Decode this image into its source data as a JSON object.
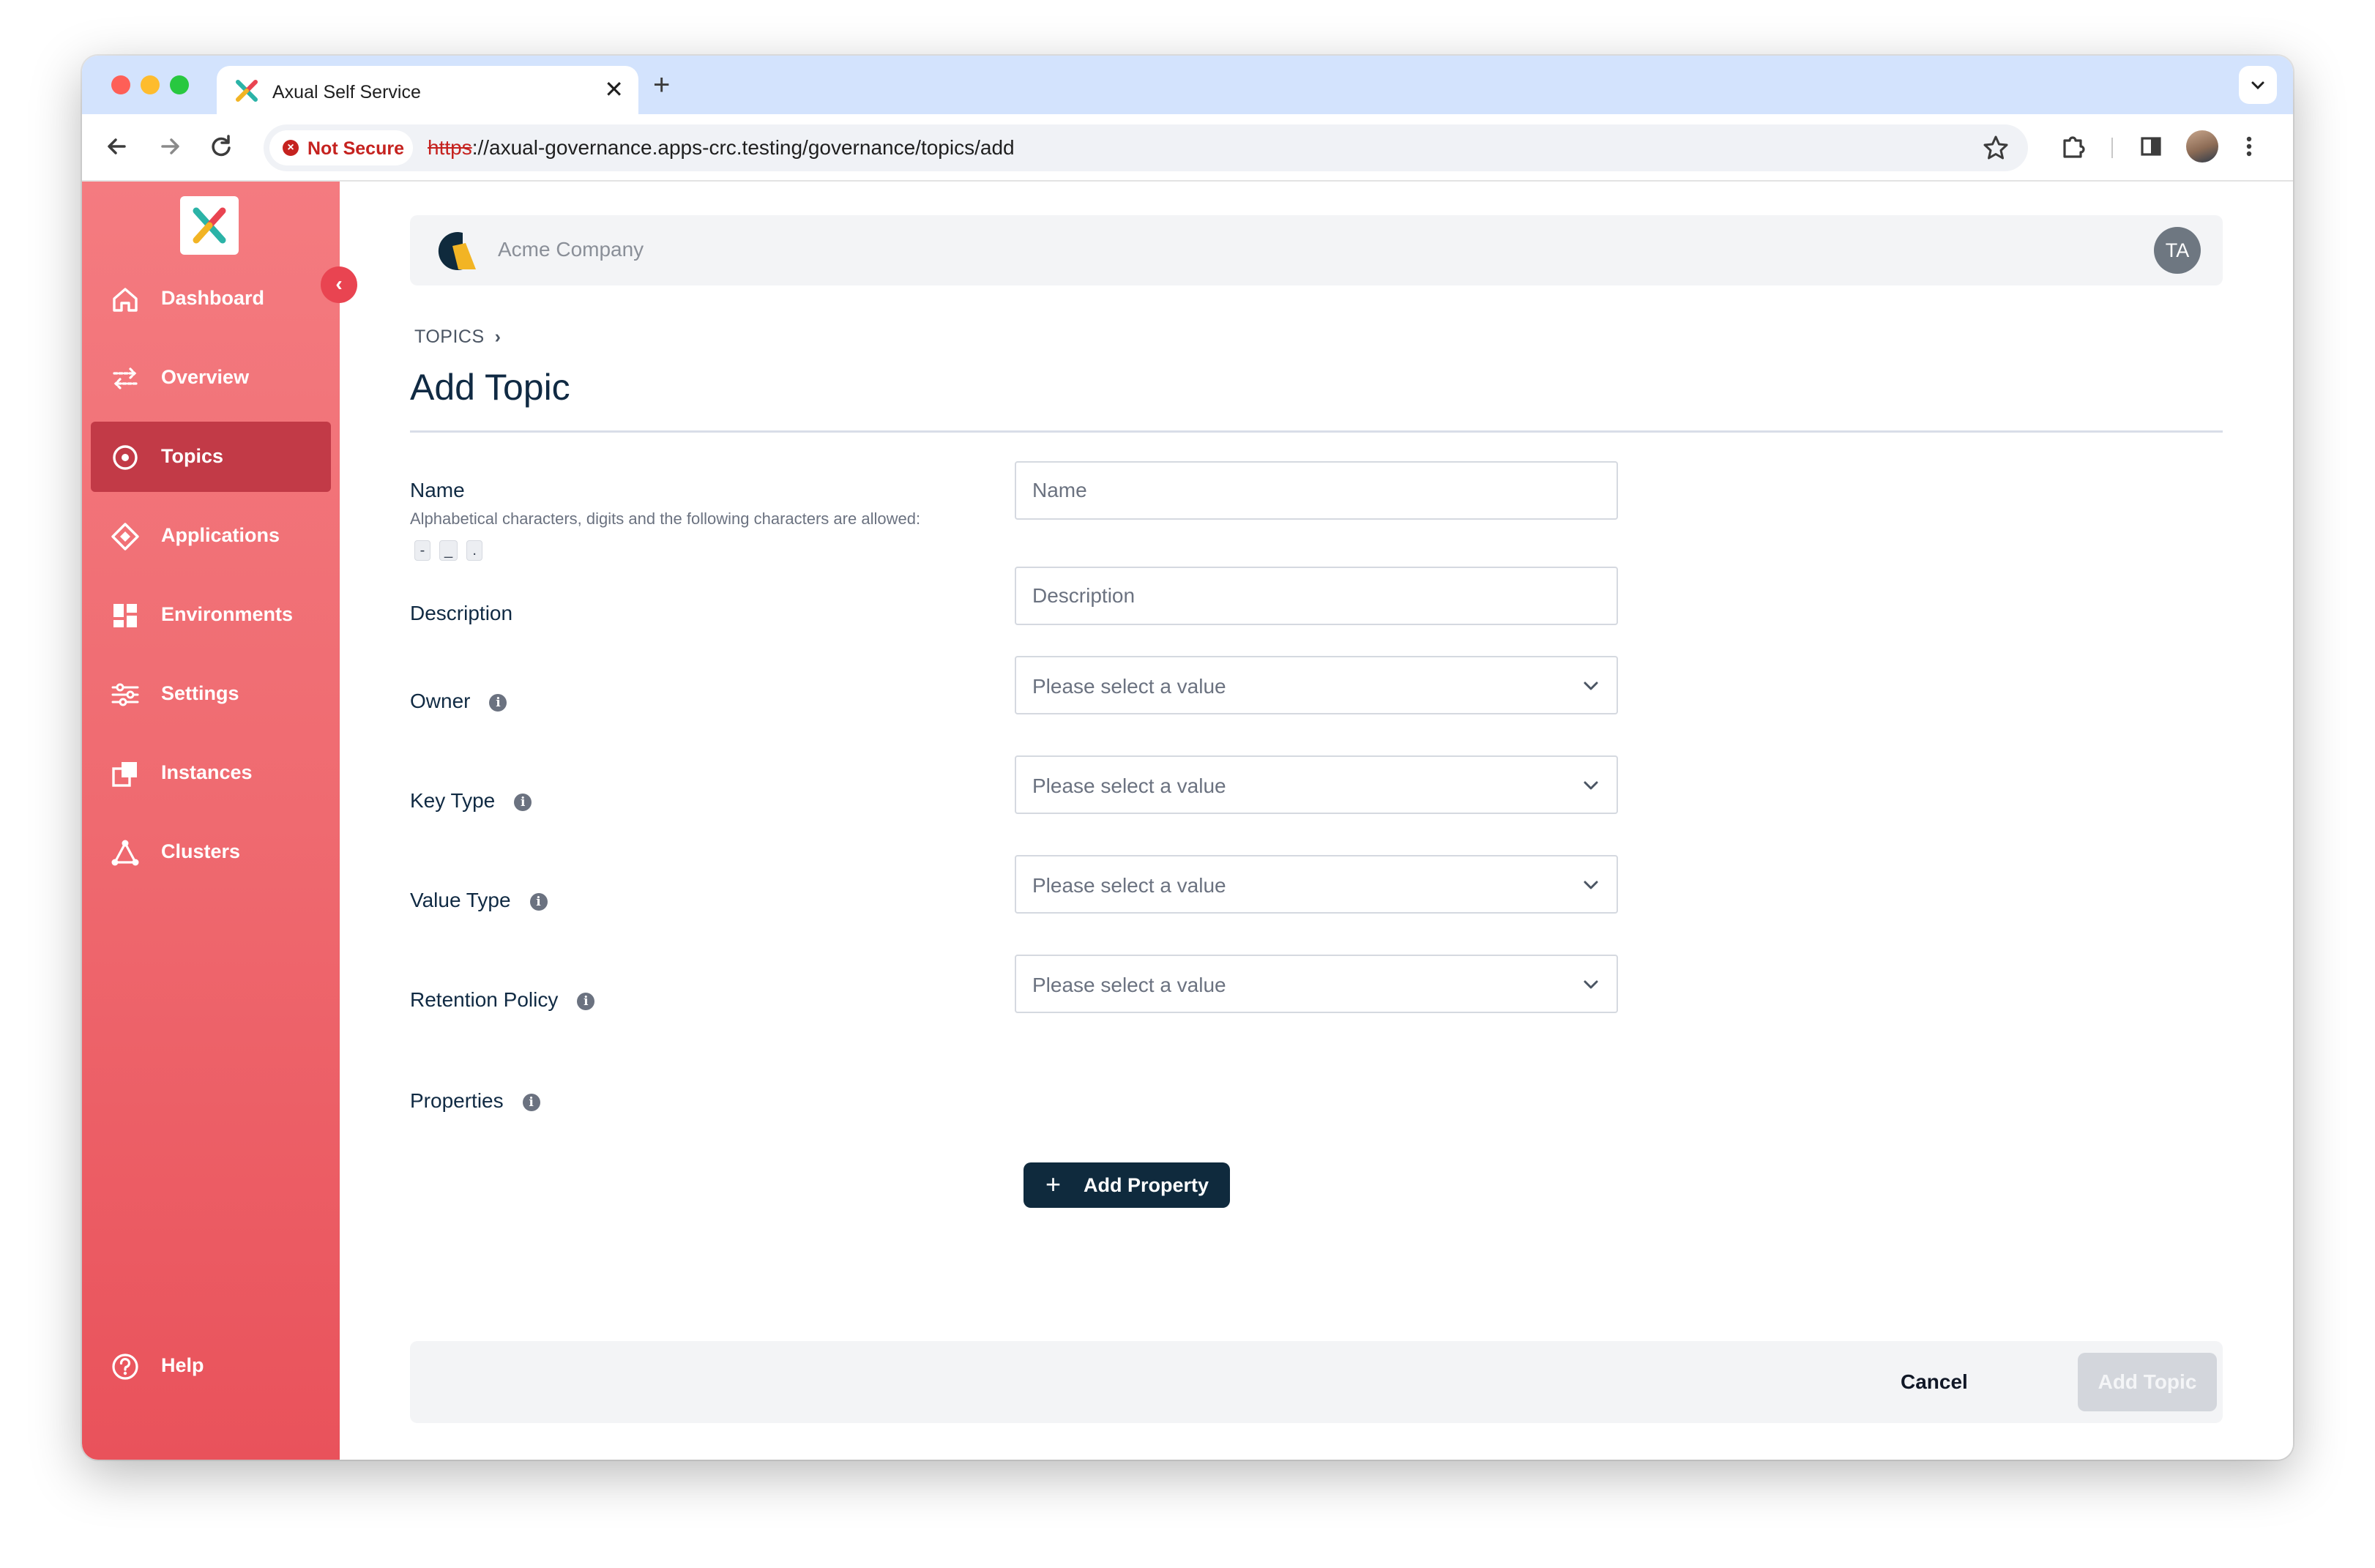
{
  "browser": {
    "tab_title": "Axual Self Service",
    "tab_close": "✕",
    "new_tab": "+",
    "security_label": "Not Secure",
    "url_scheme": "https",
    "url_rest": "://axual-governance.apps-crc.testing/governance/topics/add"
  },
  "sidebar": {
    "collapse_glyph": "‹",
    "items": [
      {
        "label": "Dashboard",
        "icon": "home-icon"
      },
      {
        "label": "Overview",
        "icon": "arrows-exchange-icon"
      },
      {
        "label": "Topics",
        "icon": "target-icon",
        "active": true
      },
      {
        "label": "Applications",
        "icon": "diamond-icon"
      },
      {
        "label": "Environments",
        "icon": "grid-icon"
      },
      {
        "label": "Settings",
        "icon": "sliders-icon"
      },
      {
        "label": "Instances",
        "icon": "instances-icon"
      },
      {
        "label": "Clusters",
        "icon": "triangle-nodes-icon"
      }
    ],
    "help_label": "Help"
  },
  "header": {
    "org_name": "Acme Company",
    "user_initials": "TA"
  },
  "page": {
    "breadcrumb": "TOPICS",
    "breadcrumb_sep": "›",
    "title": "Add Topic"
  },
  "form": {
    "name": {
      "label": "Name",
      "help_prefix": "Alphabetical characters, digits and the following characters are allowed:",
      "allowed_chars": [
        "-",
        "_",
        "."
      ],
      "placeholder": "Name"
    },
    "description": {
      "label": "Description",
      "placeholder": "Description"
    },
    "owner": {
      "label": "Owner",
      "value": "Please select a value"
    },
    "key_type": {
      "label": "Key Type",
      "value": "Please select a value"
    },
    "value_type": {
      "label": "Value Type",
      "value": "Please select a value"
    },
    "retention_policy": {
      "label": "Retention Policy",
      "value": "Please select a value"
    },
    "properties": {
      "label": "Properties",
      "add_button": "Add Property",
      "add_glyph": "+"
    },
    "info_glyph": "i"
  },
  "footer": {
    "cancel_label": "Cancel",
    "submit_label": "Add Topic"
  },
  "colors": {
    "sidebar_top": "#f47b80",
    "sidebar_bottom": "#e9525b",
    "sidebar_active": "#c23a47",
    "primary_dark": "#0f2a3d",
    "disabled_button": "#d3d6dc"
  }
}
